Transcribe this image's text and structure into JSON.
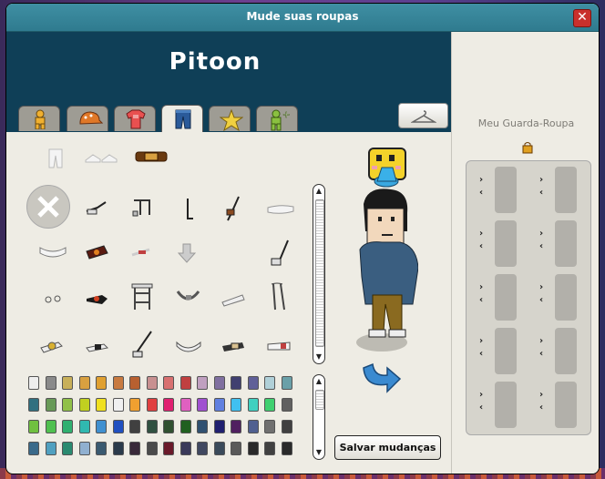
{
  "window": {
    "title": "Mude suas roupas",
    "close_label": "✕"
  },
  "header": {
    "username": "Pitoon"
  },
  "tabs": [
    {
      "icon": "body-icon",
      "active": false
    },
    {
      "icon": "hat-icon",
      "active": false
    },
    {
      "icon": "shirt-icon",
      "active": false
    },
    {
      "icon": "pants-icon",
      "active": true
    },
    {
      "icon": "star-icon",
      "active": false
    },
    {
      "icon": "add-avatar-icon",
      "active": false
    }
  ],
  "hanger_button": {
    "icon": "hanger-icon"
  },
  "wardrobe": {
    "title": "Meu Guarda-Roupa",
    "lock_icon": "padlock-icon"
  },
  "save_button": {
    "label": "Salvar mudanças"
  },
  "colors": {
    "accent": "#0f3f57",
    "titlebar": "#2f7b8f",
    "close": "#c9302c"
  },
  "palette_rows": [
    [
      "#eeeeee",
      "#8a8a8a",
      "#c8b05a",
      "#d8a040",
      "#e0a030",
      "#c87a40",
      "#b86030",
      "#c89090",
      "#d87070",
      "#c04040",
      "#c0a0c0",
      "#8070a0",
      "#404070",
      "#606098",
      "#b0d0d8",
      "#6aa0a8"
    ],
    [
      "#307080",
      "#689a58",
      "#90c048",
      "#c0d020",
      "#f0e020",
      "#f0f0f0",
      "#f0a030",
      "#e04040",
      "#e02070",
      "#e060c0",
      "#a050d0",
      "#6080e0",
      "#40c0f0",
      "#40d0c0",
      "#40d070",
      "#606060"
    ],
    [
      "#70c040",
      "#50c050",
      "#30b070",
      "#30b8b0",
      "#4090d0",
      "#2050c0",
      "#404040",
      "#305040",
      "#305030",
      "#206020",
      "#305070",
      "#202070",
      "#502060",
      "#506090",
      "#707070",
      "#404040"
    ],
    [
      "#3a6a8a",
      "#50a0c0",
      "#2a8a70",
      "#90b0d0",
      "#3a5a70",
      "#2a3a4a",
      "#3a2a3a",
      "#4a4a4a",
      "#6a1a2a",
      "#3a3a5a",
      "#404860",
      "#3a4a5a",
      "#5a5a5a",
      "#2a2a2a",
      "#404040",
      "#2a2a2a"
    ]
  ]
}
